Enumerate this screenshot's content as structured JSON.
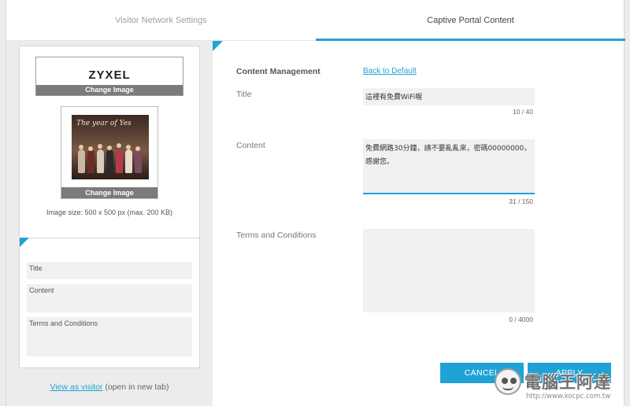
{
  "tabs": [
    {
      "label": "Visitor Network Settings",
      "active": false
    },
    {
      "label": "Captive Portal Content",
      "active": true
    }
  ],
  "preview": {
    "logo_text": "ZYXEL",
    "logo_change_label": "Change Image",
    "image_change_label": "Change Image",
    "photo_caption": "The year of Yes",
    "image_size_text": "Image size: 500 x 500 px (max. 200 KB)",
    "fields": [
      {
        "label": "Title"
      },
      {
        "label": "Content"
      },
      {
        "label": "Terms and Conditions"
      }
    ],
    "view_link": "View as visitor",
    "view_suffix": " (open in new tab)"
  },
  "form": {
    "content_management_label": "Content Management",
    "back_to_default_label": "Back to Default",
    "title_label": "Title",
    "title_value": "這裡有免費WiFi喔",
    "title_counter": "10 / 40",
    "content_label": "Content",
    "content_value": "免費網路30分鐘，請不要亂亂來，密碼00000000，感謝您。",
    "content_counter": "31 / 150",
    "terms_label": "Terms and Conditions",
    "terms_value": "",
    "terms_counter": "0 / 4000"
  },
  "buttons": {
    "cancel": "CANCEL",
    "apply": "APPLY"
  },
  "watermark": {
    "text": "電腦王阿達",
    "url": "http://www.kocpc.com.tw"
  },
  "colors": {
    "accent": "#1fa3d6",
    "panel_bg": "#ececec",
    "field_bg": "#f1f1f1"
  }
}
